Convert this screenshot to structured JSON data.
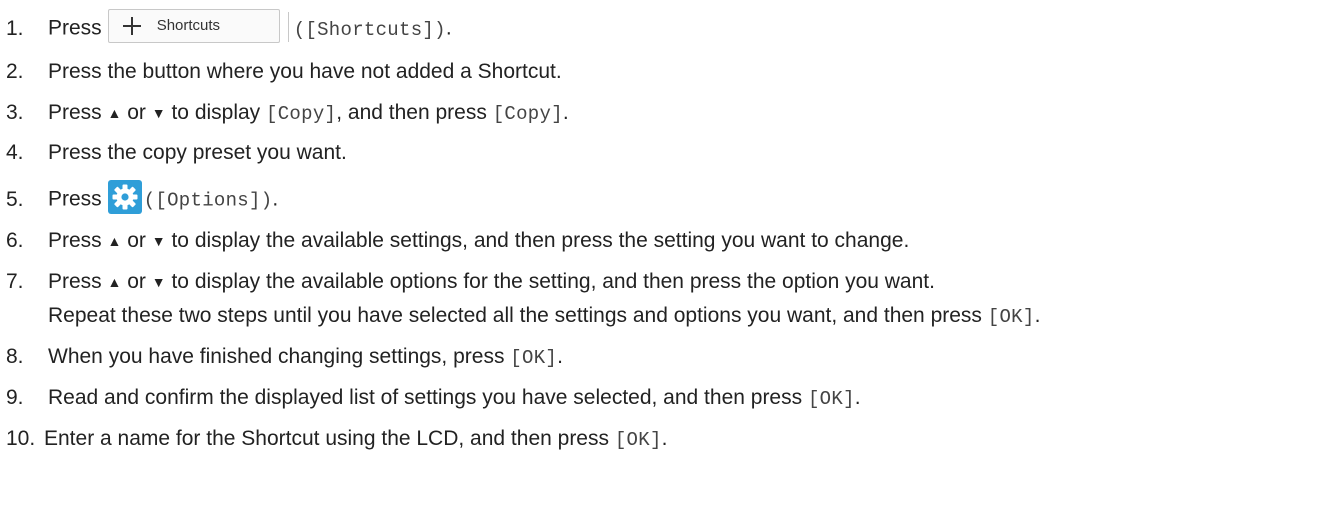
{
  "steps": [
    {
      "num": "1.",
      "pre": "Press",
      "button_label": "Shortcuts",
      "mono": "([Shortcuts])",
      "post": "."
    },
    {
      "num": "2.",
      "text": "Press the button where you have not added a Shortcut."
    },
    {
      "num": "3.",
      "pre": "Press",
      "up": "▲",
      "mid": "or",
      "down": "▼",
      "text1": "to display",
      "mono1": "[Copy]",
      "text2": ", and then press",
      "mono2": "[Copy]",
      "post": "."
    },
    {
      "num": "4.",
      "text": "Press the copy preset you want."
    },
    {
      "num": "5.",
      "pre": "Press",
      "mono": "([Options])",
      "post": "."
    },
    {
      "num": "6.",
      "pre": "Press",
      "up": "▲",
      "mid": "or",
      "down": "▼",
      "text": "to display the available settings, and then press the setting you want to change."
    },
    {
      "num": "7.",
      "pre": "Press",
      "up": "▲",
      "mid": "or",
      "down": "▼",
      "text": "to display the available options for the setting, and then press the option you want."
    },
    {
      "num": "",
      "text": "Repeat these two steps until you have selected all the settings and options you want, and then press",
      "mono": "[OK]",
      "post": "."
    },
    {
      "num": "8.",
      "text": "When you have finished changing settings, press",
      "mono": "[OK]",
      "post": "."
    },
    {
      "num": "9.",
      "text": "Read and confirm the displayed list of settings you have selected, and then press",
      "mono": "[OK]",
      "post": "."
    },
    {
      "num": "10.",
      "text": "Enter a name for the Shortcut using the LCD, and then press",
      "mono": "[OK]",
      "post": "."
    }
  ],
  "icons": {
    "plus": "plus-icon",
    "options": "gear-icon",
    "options_color": "#2f9ed8"
  }
}
